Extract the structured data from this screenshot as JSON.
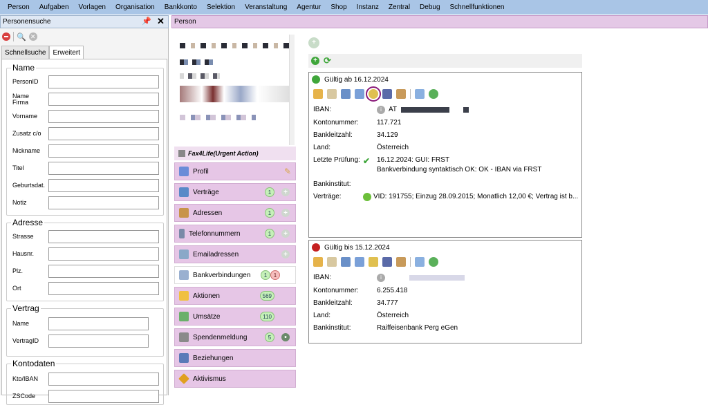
{
  "menu": [
    "Person",
    "Aufgaben",
    "Vorlagen",
    "Organisation",
    "Bankkonto",
    "Selektion",
    "Veranstaltung",
    "Agentur",
    "Shop",
    "Instanz",
    "Zentral",
    "Debug",
    "Schnellfunktionen"
  ],
  "left_panel": {
    "title": "Personensuche",
    "pin_icon": "pin-icon",
    "close_label": "✕",
    "tabs": [
      "Schnellsuche",
      "Erweitert"
    ],
    "groups": {
      "name": {
        "title": "Name",
        "fields": [
          "PersonID",
          "Name Firma",
          "Vorname",
          "Zusatz c/o",
          "Nickname",
          "Titel",
          "Geburtsdat.",
          "Notiz"
        ]
      },
      "adresse": {
        "title": "Adresse",
        "fields": [
          "Strasse",
          "Hausnr.",
          "Plz.",
          "Ort"
        ]
      },
      "vertrag": {
        "title": "Vertrag",
        "fields": [
          "Name",
          "VertragID"
        ]
      },
      "kontodaten": {
        "title": "Kontodaten",
        "fields": [
          "Kto/IBAN",
          "ZSCode"
        ]
      }
    }
  },
  "person_panel": {
    "title": "Person",
    "fax_label": "Fax4Life(Urgent Action)",
    "nav": [
      {
        "label": "Profil",
        "badges": []
      },
      {
        "label": "Verträge",
        "badges": [
          "1"
        ]
      },
      {
        "label": "Adressen",
        "badges": [
          "1"
        ]
      },
      {
        "label": "Telefonnummern",
        "badges": [
          "1"
        ]
      },
      {
        "label": "Emailadressen",
        "badges": []
      },
      {
        "label": "Bankverbindungen",
        "badges": [
          "1",
          "1"
        ]
      },
      {
        "label": "Aktionen",
        "badges": [
          "569"
        ]
      },
      {
        "label": "Umsätze",
        "badges": [
          "110"
        ]
      },
      {
        "label": "Spendenmeldung",
        "badges": [
          "5"
        ]
      },
      {
        "label": "Beziehungen",
        "badges": []
      },
      {
        "label": "Aktivismus",
        "badges": []
      }
    ]
  },
  "accounts": [
    {
      "status_color": "#3fa63a",
      "header": "Gültig ab 16.12.2024",
      "labels": {
        "iban": "IBAN:",
        "kontonummer": "Kontonummer:",
        "blz": "Bankleitzahl:",
        "land": "Land:",
        "pruefung": "Letzte Prüfung:",
        "institut": "Bankinstitut:",
        "vertraege": "Verträge:"
      },
      "iban_prefix": "AT",
      "kontonummer": "117.721",
      "blz": "34.129",
      "land": "Österreich",
      "pruefung_line1": "16.12.2024: GUI: FRST",
      "pruefung_line2": "Bankverbindung syntaktisch OK: OK - IBAN via FRST",
      "institut": "",
      "vertraege": "VID: 191755; Einzug 28.09.2015; Monatlich 12,00 €; Vertrag ist b..."
    },
    {
      "status_color": "#c52020",
      "header": "Gültig bis 15.12.2024",
      "labels": {
        "iban": "IBAN:",
        "kontonummer": "Kontonummer:",
        "blz": "Bankleitzahl:",
        "land": "Land:",
        "institut": "Bankinstitut:"
      },
      "kontonummer": "6.255.418",
      "blz": "34.777",
      "land": "Österreich",
      "institut": "Raiffeisenbank Perg eGen"
    }
  ]
}
